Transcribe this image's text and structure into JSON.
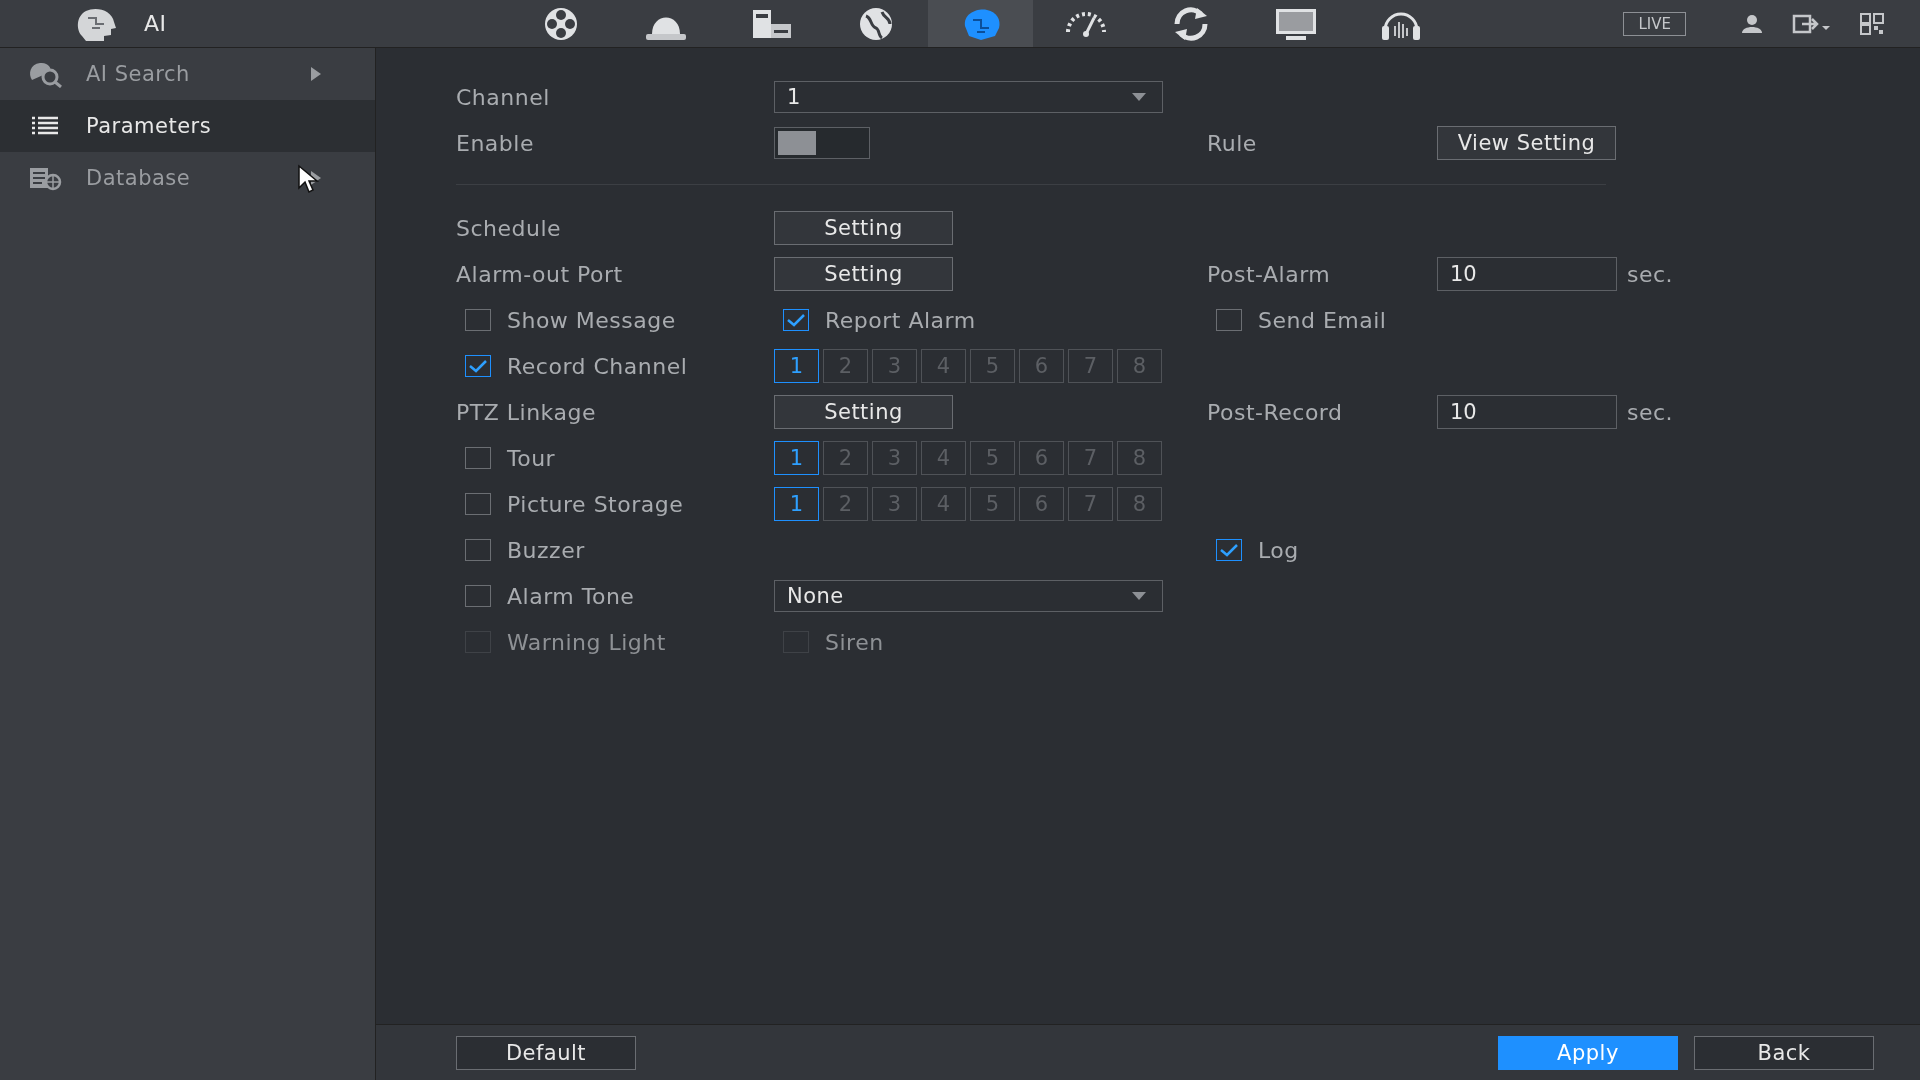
{
  "header": {
    "title": "AI",
    "nav_icons": [
      {
        "kind": "film",
        "selected": false
      },
      {
        "kind": "dome",
        "selected": false
      },
      {
        "kind": "storage",
        "selected": false
      },
      {
        "kind": "globe",
        "selected": false
      },
      {
        "kind": "ai",
        "selected": true
      },
      {
        "kind": "gauge",
        "selected": false
      },
      {
        "kind": "refresh",
        "selected": false
      },
      {
        "kind": "monitor",
        "selected": false
      },
      {
        "kind": "headset",
        "selected": false
      }
    ],
    "live": "LIVE"
  },
  "sidebar": {
    "items": [
      {
        "label": "AI Search",
        "kind": "search",
        "selected": false,
        "expandable": true
      },
      {
        "label": "Parameters",
        "kind": "list",
        "selected": true,
        "expandable": false
      },
      {
        "label": "Database",
        "kind": "database",
        "selected": false,
        "expandable": true
      }
    ]
  },
  "rows": [
    {
      "kind": "fields",
      "label": {
        "kind": "text",
        "text": "Channel"
      },
      "control": {
        "kind": "select",
        "value": "1"
      }
    },
    {
      "kind": "fields",
      "label": {
        "kind": "text",
        "text": "Enable"
      },
      "control": {
        "kind": "toggle",
        "on": false
      },
      "right_label": {
        "kind": "text",
        "text": "Rule"
      },
      "right_control": {
        "kind": "button",
        "text": "View Setting"
      }
    },
    {
      "kind": "divider"
    },
    {
      "kind": "fields",
      "label": {
        "kind": "text",
        "text": "Schedule"
      },
      "control": {
        "kind": "button",
        "text": "Setting"
      }
    },
    {
      "kind": "fields",
      "label": {
        "kind": "text",
        "text": "Alarm-out Port"
      },
      "control": {
        "kind": "button",
        "text": "Setting"
      },
      "right_label": {
        "kind": "text",
        "text": "Post-Alarm"
      },
      "right_control": {
        "kind": "field",
        "value": "10",
        "unit": "sec."
      }
    },
    {
      "kind": "fields",
      "label": {
        "kind": "checkbox",
        "text": "Show Message",
        "checked": false,
        "disabled": false
      },
      "control": {
        "kind": "checkbox",
        "text": "Report Alarm",
        "checked": true,
        "disabled": false
      },
      "right_label": {
        "kind": "checkbox",
        "text": "Send Email",
        "checked": false,
        "disabled": false
      }
    },
    {
      "kind": "fields",
      "label": {
        "kind": "checkbox",
        "text": "Record Channel",
        "checked": true,
        "disabled": false
      },
      "control": {
        "kind": "channels",
        "channels": [
          {
            "label": "1",
            "selected": true
          },
          {
            "label": "2",
            "selected": false
          },
          {
            "label": "3",
            "selected": false
          },
          {
            "label": "4",
            "selected": false
          },
          {
            "label": "5",
            "selected": false
          },
          {
            "label": "6",
            "selected": false
          },
          {
            "label": "7",
            "selected": false
          },
          {
            "label": "8",
            "selected": false
          }
        ]
      }
    },
    {
      "kind": "fields",
      "label": {
        "kind": "text",
        "text": "PTZ Linkage"
      },
      "control": {
        "kind": "button",
        "text": "Setting"
      },
      "right_label": {
        "kind": "text",
        "text": "Post-Record"
      },
      "right_control": {
        "kind": "field",
        "value": "10",
        "unit": "sec."
      }
    },
    {
      "kind": "fields",
      "label": {
        "kind": "checkbox",
        "text": "Tour",
        "checked": false,
        "disabled": false
      },
      "control": {
        "kind": "channels",
        "channels": [
          {
            "label": "1",
            "selected": true
          },
          {
            "label": "2",
            "selected": false
          },
          {
            "label": "3",
            "selected": false
          },
          {
            "label": "4",
            "selected": false
          },
          {
            "label": "5",
            "selected": false
          },
          {
            "label": "6",
            "selected": false
          },
          {
            "label": "7",
            "selected": false
          },
          {
            "label": "8",
            "selected": false
          }
        ]
      }
    },
    {
      "kind": "fields",
      "label": {
        "kind": "checkbox",
        "text": "Picture Storage",
        "checked": false,
        "disabled": false
      },
      "control": {
        "kind": "channels",
        "channels": [
          {
            "label": "1",
            "selected": true
          },
          {
            "label": "2",
            "selected": false
          },
          {
            "label": "3",
            "selected": false
          },
          {
            "label": "4",
            "selected": false
          },
          {
            "label": "5",
            "selected": false
          },
          {
            "label": "6",
            "selected": false
          },
          {
            "label": "7",
            "selected": false
          },
          {
            "label": "8",
            "selected": false
          }
        ]
      }
    },
    {
      "kind": "fields",
      "label": {
        "kind": "checkbox",
        "text": "Buzzer",
        "checked": false,
        "disabled": false
      },
      "right_label": {
        "kind": "checkbox",
        "text": "Log",
        "checked": true,
        "disabled": false
      }
    },
    {
      "kind": "fields",
      "label": {
        "kind": "checkbox",
        "text": "Alarm Tone",
        "checked": false,
        "disabled": false
      },
      "control": {
        "kind": "select",
        "value": "None"
      }
    },
    {
      "kind": "fields",
      "label": {
        "kind": "checkbox",
        "text": "Warning Light",
        "checked": false,
        "disabled": true
      },
      "control": {
        "kind": "checkbox",
        "text": "Siren",
        "checked": false,
        "disabled": true
      }
    }
  ],
  "footer": {
    "left_buttons": [
      {
        "text": "Default",
        "kind": "normal"
      }
    ],
    "right_buttons": [
      {
        "text": "Apply",
        "kind": "primary"
      },
      {
        "text": "Back",
        "kind": "normal"
      }
    ]
  }
}
